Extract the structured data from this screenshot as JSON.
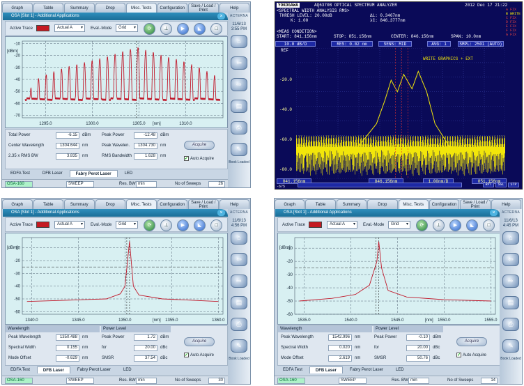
{
  "tabs": [
    "Graph",
    "Table",
    "Summary",
    "Drop",
    "Misc. Tests",
    "Configuration",
    "Save / Load / Print",
    "Help"
  ],
  "title": "OSA [Slot 1]  -  Additional Applications",
  "toolbar": {
    "active_trace_label": "Active Trace",
    "trace_value": "Actual A",
    "eval_label": "Eval.-Mode",
    "eval_value": "Grid"
  },
  "brand": "ACTERNA",
  "acquire_label": "Acquire",
  "auto_acquire_label": "Auto Acquire",
  "book_label": "Book Loaded",
  "subtabs": [
    "EDFA Test",
    "DFB Laser",
    "Fabry Perot Laser",
    "LED"
  ],
  "status": {
    "module": "OSA-160",
    "sweep": "SWEEP",
    "res_label": "Res. BW",
    "res_value": "min",
    "sweeps_label": "No of Sweeps"
  },
  "screen1": {
    "time": "11/6/13 3:55 PM",
    "y_unit": "[dBm]",
    "x_unit": "[nm]",
    "y_ticks": [
      "-10",
      "-20",
      "-30",
      "-40",
      "-50",
      "-60",
      "-70"
    ],
    "x_ticks": [
      "1295.0",
      "1300.0",
      "1305.0",
      "1310.0"
    ],
    "rows": [
      {
        "l1": "Total Power",
        "v1": "-6.15",
        "u1": "dBm",
        "l2": "Peak Power",
        "v2": "-12.48",
        "u2": "dBm"
      },
      {
        "l1": "Center Wavelength",
        "v1": "1304.644",
        "u1": "nm",
        "l2": "Peak Wavelen.",
        "v2": "1304.730",
        "u2": "nm"
      },
      {
        "l1": "2.35 x RMS BW",
        "v1": "3.835",
        "u1": "nm",
        "l2": "RMS Bandwidth",
        "v2": "1.628",
        "u2": "nm"
      }
    ],
    "sweeps": "26",
    "selected_subtab": 2,
    "chart_data": {
      "type": "line",
      "xlabel": "[nm]",
      "ylabel": "[dBm]",
      "xlim": [
        1292.5,
        1314.0
      ],
      "ylim": [
        -72,
        -8
      ],
      "series": [
        {
          "values": [
            [
              1293.0,
              -52
            ],
            [
              1294.0,
              -40
            ],
            [
              1295.0,
              -36
            ],
            [
              1296.0,
              -33
            ],
            [
              1297.0,
              -30
            ],
            [
              1298.0,
              -28
            ],
            [
              1299.0,
              -26
            ],
            [
              1300.0,
              -24
            ],
            [
              1301.0,
              -22
            ],
            [
              1302.0,
              -20
            ],
            [
              1303.0,
              -17
            ],
            [
              1304.0,
              -15
            ],
            [
              1304.7,
              -12.5
            ],
            [
              1305.5,
              -15
            ],
            [
              1306.5,
              -17
            ],
            [
              1307.5,
              -20
            ],
            [
              1308.5,
              -22
            ],
            [
              1309.5,
              -24
            ],
            [
              1310.5,
              -27
            ],
            [
              1311.5,
              -30
            ],
            [
              1312.5,
              -34
            ],
            [
              1313.5,
              -38
            ]
          ]
        }
      ]
    }
  },
  "screen2": {
    "brand": "YOKOGAWA",
    "header": "AQ6370B OPTICAL SPECTRUM ANALYZER",
    "datetime": "2012 Dec 17 21:22",
    "spectral": "<SPECTRAL WIDTH ANALYSIS RMS>",
    "thresh_label": "THRESH LEVEL:",
    "thresh_value": "20.00dB",
    "k_label": "K:",
    "k_value": "1.00",
    "dl_label": "ΔL:",
    "dl_value": "0.3467nm",
    "lc_label": "λC:",
    "lc_value": "846.3777nm",
    "meas": "<MEAS CONDITION>",
    "start": "START: 841.156nm",
    "stop": "STOP: 851.156nm",
    "center": "CENTER: 846.156nm",
    "span": "SPAN: 10.0nm",
    "scale": "10.0 dB/D",
    "res": "RES: 0.02 nm",
    "sens": "SENS: MID",
    "avg": "AVG: 1",
    "smpl": "SMPL: 2501 (AUTO)",
    "ref": "REF",
    "write": "WRITE GRAPHICS + EXT",
    "y_ticks": [
      "-20.0",
      "-40.0",
      "-60.0",
      "-80.0"
    ],
    "x_left": "841.156nm",
    "x_center": "846.156nm",
    "x_right": "851.156nm",
    "x_div": "1.00nm/D",
    "legend": [
      "A FIX",
      "B WRITE",
      "C FIX",
      "D FIX",
      "E FIX",
      "F FIX",
      "G FIX"
    ],
    "softkeys": [
      "-675",
      "RPT",
      "SGL",
      "STP"
    ],
    "chart_data": {
      "type": "line",
      "xlabel": "",
      "ylabel": "",
      "xlim": [
        841.156,
        851.156
      ],
      "ylim": [
        -90,
        0
      ],
      "series": [
        {
          "name": "A FIX",
          "values": [
            [
              841.2,
              -70
            ],
            [
              844.0,
              -70
            ],
            [
              845.0,
              -52
            ],
            [
              845.4,
              -36
            ],
            [
              845.7,
              -22
            ],
            [
              846.0,
              -30
            ],
            [
              846.3,
              -18
            ],
            [
              846.7,
              -28
            ],
            [
              847.0,
              -16
            ],
            [
              847.4,
              -30
            ],
            [
              847.8,
              -52
            ],
            [
              848.5,
              -68
            ],
            [
              851.1,
              -72
            ]
          ]
        }
      ]
    }
  },
  "screen3": {
    "time": "11/6/13 4:56 PM",
    "y_unit": "[dBm]",
    "x_unit": "[nm]",
    "y_ticks": [
      "-10",
      "-20",
      "-30",
      "-40",
      "-50",
      "-60"
    ],
    "x_ticks": [
      "1340.0",
      "1345.0",
      "1350.0",
      "1355.0",
      "1360.0"
    ],
    "hdr1": "Wavelength",
    "hdr2": "Power Level",
    "rows": [
      {
        "l1": "Peak Wavelength",
        "v1": "1350.488",
        "u1": "nm",
        "l2": "Peak Power",
        "v2": "1.72",
        "u2": "dBm"
      },
      {
        "l1": "Spectral Width",
        "v1": "0.155",
        "u1": "nm",
        "l2": "for",
        "v2": "20.00",
        "u2": "dBc"
      },
      {
        "l1": "Mode Offset",
        "v1": "-0.629",
        "u1": "nm",
        "l2": "SMSR",
        "v2": "37.54",
        "u2": "dBc"
      }
    ],
    "sweeps": "30",
    "selected_subtab": 1,
    "chart_data": {
      "type": "line",
      "xlabel": "[nm]",
      "ylabel": "[dBm]",
      "xlim": [
        1339.0,
        1360.5
      ],
      "ylim": [
        -62,
        -2
      ],
      "series": [
        {
          "values": [
            [
              1339.5,
              -52
            ],
            [
              1344.0,
              -51
            ],
            [
              1348.0,
              -50
            ],
            [
              1349.5,
              -46
            ],
            [
              1350.0,
              -40
            ],
            [
              1350.49,
              -5
            ],
            [
              1350.9,
              -40
            ],
            [
              1351.5,
              -47
            ],
            [
              1354.0,
              -50
            ],
            [
              1357.0,
              -51
            ],
            [
              1360.0,
              -52
            ]
          ]
        }
      ]
    }
  },
  "screen4": {
    "time": "11/6/13 4:45 PM",
    "y_unit": "[dBm]",
    "x_unit": "[nm]",
    "y_ticks": [
      "-10",
      "-20",
      "-30",
      "-40",
      "-50",
      "-60"
    ],
    "x_ticks": [
      "1535.0",
      "1540.0",
      "1545.0",
      "1550.0",
      "1555.0"
    ],
    "hdr1": "Wavelength",
    "hdr2": "Power Level",
    "rows": [
      {
        "l1": "Peak Wavelength",
        "v1": "1542.996",
        "u1": "nm",
        "l2": "Peak Power",
        "v2": "-0.10",
        "u2": "dBm"
      },
      {
        "l1": "Spectral Width",
        "v1": "0.020",
        "u1": "nm",
        "l2": "for",
        "v2": "20.00",
        "u2": "dBc"
      },
      {
        "l1": "Mode Offset",
        "v1": "2.619",
        "u1": "nm",
        "l2": "SMSR",
        "v2": "50.76",
        "u2": "dBc"
      }
    ],
    "sweeps": "14",
    "selected_subtab": 1,
    "chart_data": {
      "type": "line",
      "xlabel": "[nm]",
      "ylabel": "[dBm]",
      "xlim": [
        1534.0,
        1555.5
      ],
      "ylim": [
        -60,
        -2
      ],
      "series": [
        {
          "values": [
            [
              1534.5,
              -50
            ],
            [
              1538.0,
              -48
            ],
            [
              1540.5,
              -45
            ],
            [
              1542.0,
              -38
            ],
            [
              1542.8,
              -20
            ],
            [
              1543.0,
              -5
            ],
            [
              1543.3,
              -25
            ],
            [
              1544.0,
              -42
            ],
            [
              1546.0,
              -47
            ],
            [
              1550.0,
              -49
            ],
            [
              1555.0,
              -50
            ]
          ]
        }
      ]
    }
  },
  "colors": {
    "trace": "#c0182a",
    "plot_bg": "#d8f0f2",
    "yoko_bg": "#0a0a58",
    "yoko_trace": "#f2e60a"
  }
}
